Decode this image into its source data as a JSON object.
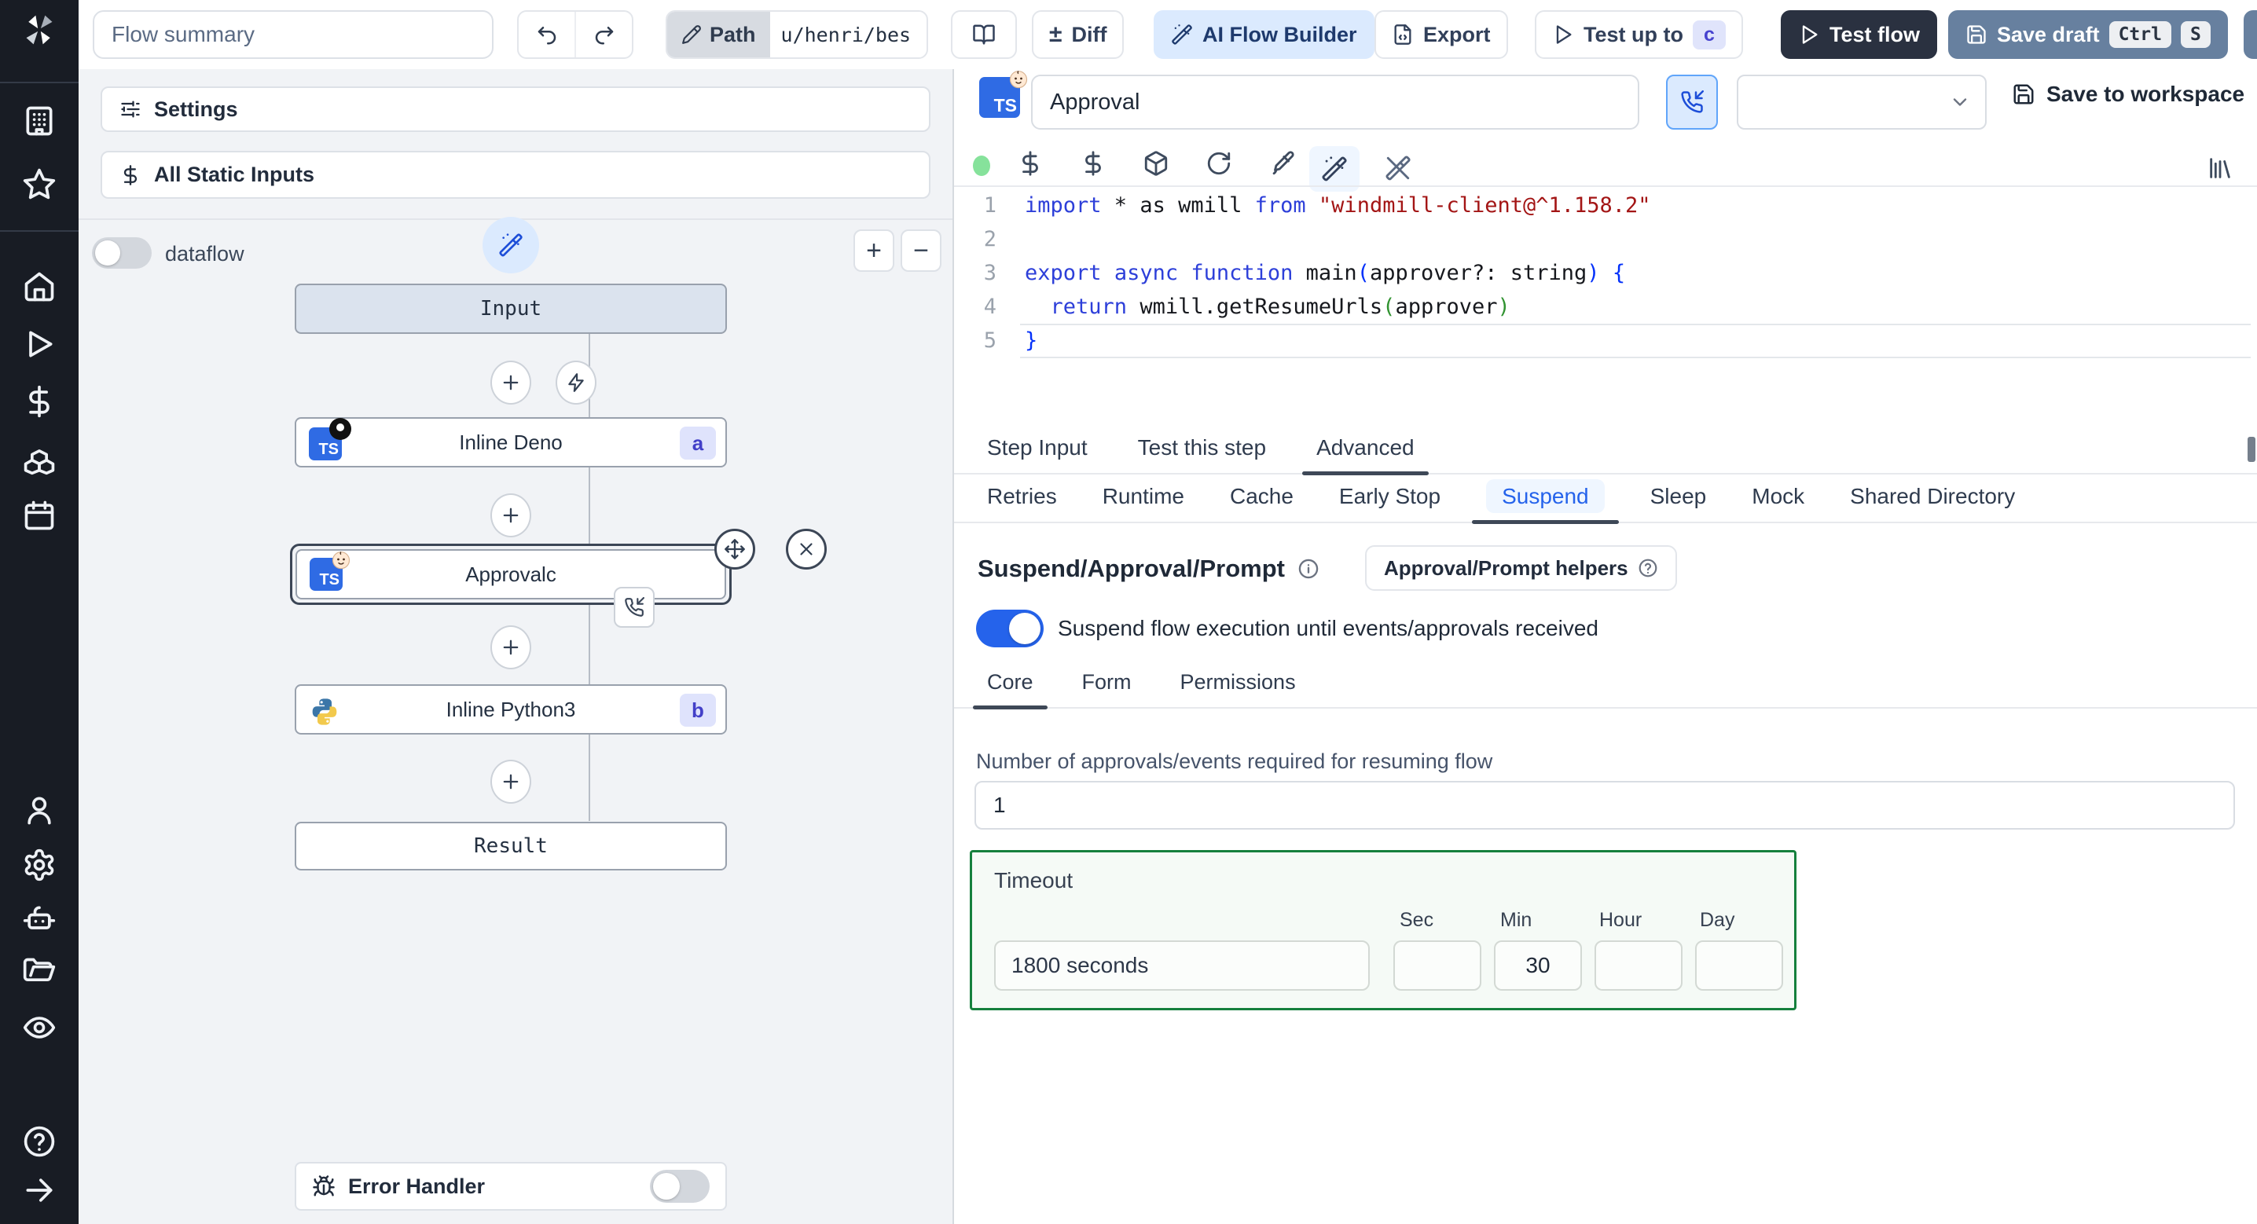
{
  "topbar": {
    "flow_summary_placeholder": "Flow summary",
    "path_label": "Path",
    "path_value": "u/henri/bes",
    "diff_glyph": "±",
    "diff_label": "Diff",
    "ai_flow_builder_label": "AI Flow Builder",
    "export_label": "Export",
    "test_up_to_label": "Test up to",
    "test_up_to_badge": "c",
    "test_flow_label": "Test flow",
    "save_draft_label": "Save draft",
    "kbd_ctrl": "Ctrl",
    "kbd_s": "S"
  },
  "sidebar": {
    "icons": [
      "windmill-logo",
      "workspace",
      "favorites",
      "home",
      "runs",
      "variables",
      "resources",
      "schedules",
      "users",
      "settings",
      "workers",
      "folders",
      "audit-logs",
      "help",
      "expand"
    ]
  },
  "flow_panel": {
    "settings_label": "Settings",
    "static_inputs_label": "All Static Inputs",
    "dataflow_label": "dataflow",
    "zoom_in": "+",
    "zoom_out": "−",
    "nodes": {
      "input": "Input",
      "deno": {
        "label": "Inline Deno",
        "badge": "a"
      },
      "approval": {
        "label": "Approval",
        "badge": "c"
      },
      "python": {
        "label": "Inline Python3",
        "badge": "b"
      },
      "result": "Result"
    },
    "error_handler_label": "Error Handler"
  },
  "step_editor": {
    "language_badge": "TS",
    "name_value": "Approval",
    "save_to_workspace_label": "Save to workspace",
    "code": {
      "line_numbers": [
        "1",
        "2",
        "3",
        "4",
        "5"
      ],
      "lines": [
        [
          {
            "t": "import",
            "c": "kw"
          },
          {
            "t": " * as wmill ",
            "c": "plain"
          },
          {
            "t": "from",
            "c": "kw"
          },
          {
            "t": " ",
            "c": "plain"
          },
          {
            "t": "\"windmill-client@^1.158.2\"",
            "c": "str"
          }
        ],
        [],
        [
          {
            "t": "export",
            "c": "kw"
          },
          {
            "t": " ",
            "c": "plain"
          },
          {
            "t": "async",
            "c": "kw"
          },
          {
            "t": " ",
            "c": "plain"
          },
          {
            "t": "function",
            "c": "kw"
          },
          {
            "t": " main",
            "c": "plain"
          },
          {
            "t": "(",
            "c": "p1"
          },
          {
            "t": "approver?: string",
            "c": "plain"
          },
          {
            "t": ")",
            "c": "p1"
          },
          {
            "t": " ",
            "c": "plain"
          },
          {
            "t": "{",
            "c": "br"
          }
        ],
        [
          {
            "t": "  ",
            "c": "plain"
          },
          {
            "t": "return",
            "c": "kw"
          },
          {
            "t": " wmill.getResumeUrls",
            "c": "plain"
          },
          {
            "t": "(",
            "c": "p2"
          },
          {
            "t": "approver",
            "c": "plain"
          },
          {
            "t": ")",
            "c": "p2"
          }
        ],
        [
          {
            "t": "}",
            "c": "br"
          }
        ]
      ]
    },
    "tabs": [
      "Step Input",
      "Test this step",
      "Advanced"
    ],
    "advanced_tabs": [
      "Retries",
      "Runtime",
      "Cache",
      "Early Stop",
      "Suspend",
      "Sleep",
      "Mock",
      "Shared Directory"
    ],
    "suspend": {
      "heading": "Suspend/Approval/Prompt",
      "helpers_button_label": "Approval/Prompt helpers",
      "toggle_label": "Suspend flow execution until events/approvals received",
      "subtabs": [
        "Core",
        "Form",
        "Permissions"
      ],
      "approvals_label": "Number of approvals/events required for resuming flow",
      "approvals_value": "1",
      "timeout_label": "Timeout",
      "timeout_display": "1800 seconds",
      "unit_labels": [
        "Sec",
        "Min",
        "Hour",
        "Day"
      ],
      "unit_values": [
        "",
        "30",
        "",
        ""
      ]
    }
  },
  "colors": {
    "accent_blue": "#2563eb",
    "ai_button_bg": "#dbeafe",
    "save_draft_bg": "#67809f",
    "test_flow_bg": "#2a3140",
    "timeout_border_green": "#15803d",
    "badge_bg": "#dfe3fc",
    "badge_text": "#4340c8",
    "sidebar_bg": "#181c24",
    "status_dot_green": "#86e29b"
  }
}
